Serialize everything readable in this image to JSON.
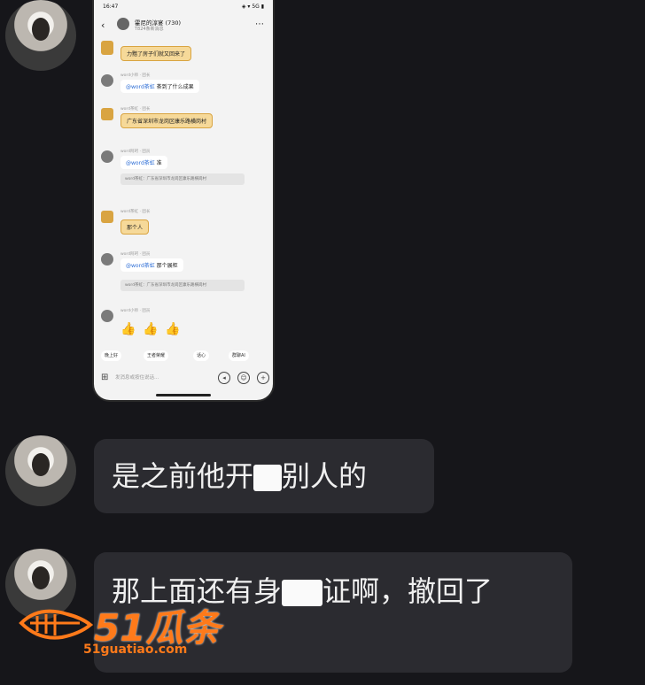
{
  "phone": {
    "status_time": "16:47",
    "status_icons": "◈ ▾ 5G ▮",
    "group_title": "霍尼的淳宴 (730)",
    "group_sub": "T824条新消息",
    "messages": [
      {
        "name": "",
        "text": "力黯了房子们就又回来了",
        "style": "gold"
      },
      {
        "name": "word小师 · 团长",
        "mention": "@word茶虹",
        "text": "茶到了什么成果",
        "style": "white"
      },
      {
        "name": "word茶虹 · 团长",
        "text": "广东省深圳市龙岗区康乐路横岗村",
        "style": "gold"
      },
      {
        "name": "word阿珂 · 团员",
        "mention": "@word茶虹",
        "text": "准",
        "quote": "word茶虹：广东省深圳市龙岗区康乐路横岗村",
        "style": "white"
      },
      {
        "name": "word茶虹 · 团长",
        "text": "那个人",
        "style": "gold"
      },
      {
        "name": "word阿珂 · 团员",
        "mention": "@word茶虹",
        "text": "那个展柜",
        "quote": "word茶虹：广东省深圳市龙岗区康乐路横岗村",
        "style": "white"
      },
      {
        "name": "word小师 · 团员",
        "text": "",
        "style": "none"
      }
    ],
    "quick_chips": [
      "晚上好",
      "王者荣耀",
      "话心",
      "群聊AI"
    ],
    "input_placeholder": "发消息或按住说话..."
  },
  "chat": {
    "bubble1_text_a": "是之前他开",
    "bubble1_text_b": "别人的",
    "bubble2_text_a": "那上面还有身",
    "bubble2_text_b": "证啊，撤回了"
  },
  "watermark": {
    "brand": "51瓜条",
    "url": "51guatiao.com"
  }
}
